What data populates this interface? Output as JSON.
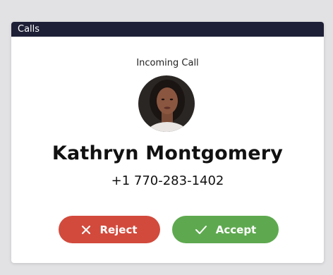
{
  "window": {
    "title": "Calls"
  },
  "call": {
    "heading": "Incoming Call",
    "caller_name": "Kathryn Montgomery",
    "caller_phone": "+1 770-283-1402"
  },
  "actions": {
    "reject_label": "Reject",
    "accept_label": "Accept",
    "reject_icon": "close-icon",
    "accept_icon": "check-icon"
  },
  "colors": {
    "titlebar": "#1d1f36",
    "reject": "#d24a3c",
    "accept": "#5ea94f"
  }
}
